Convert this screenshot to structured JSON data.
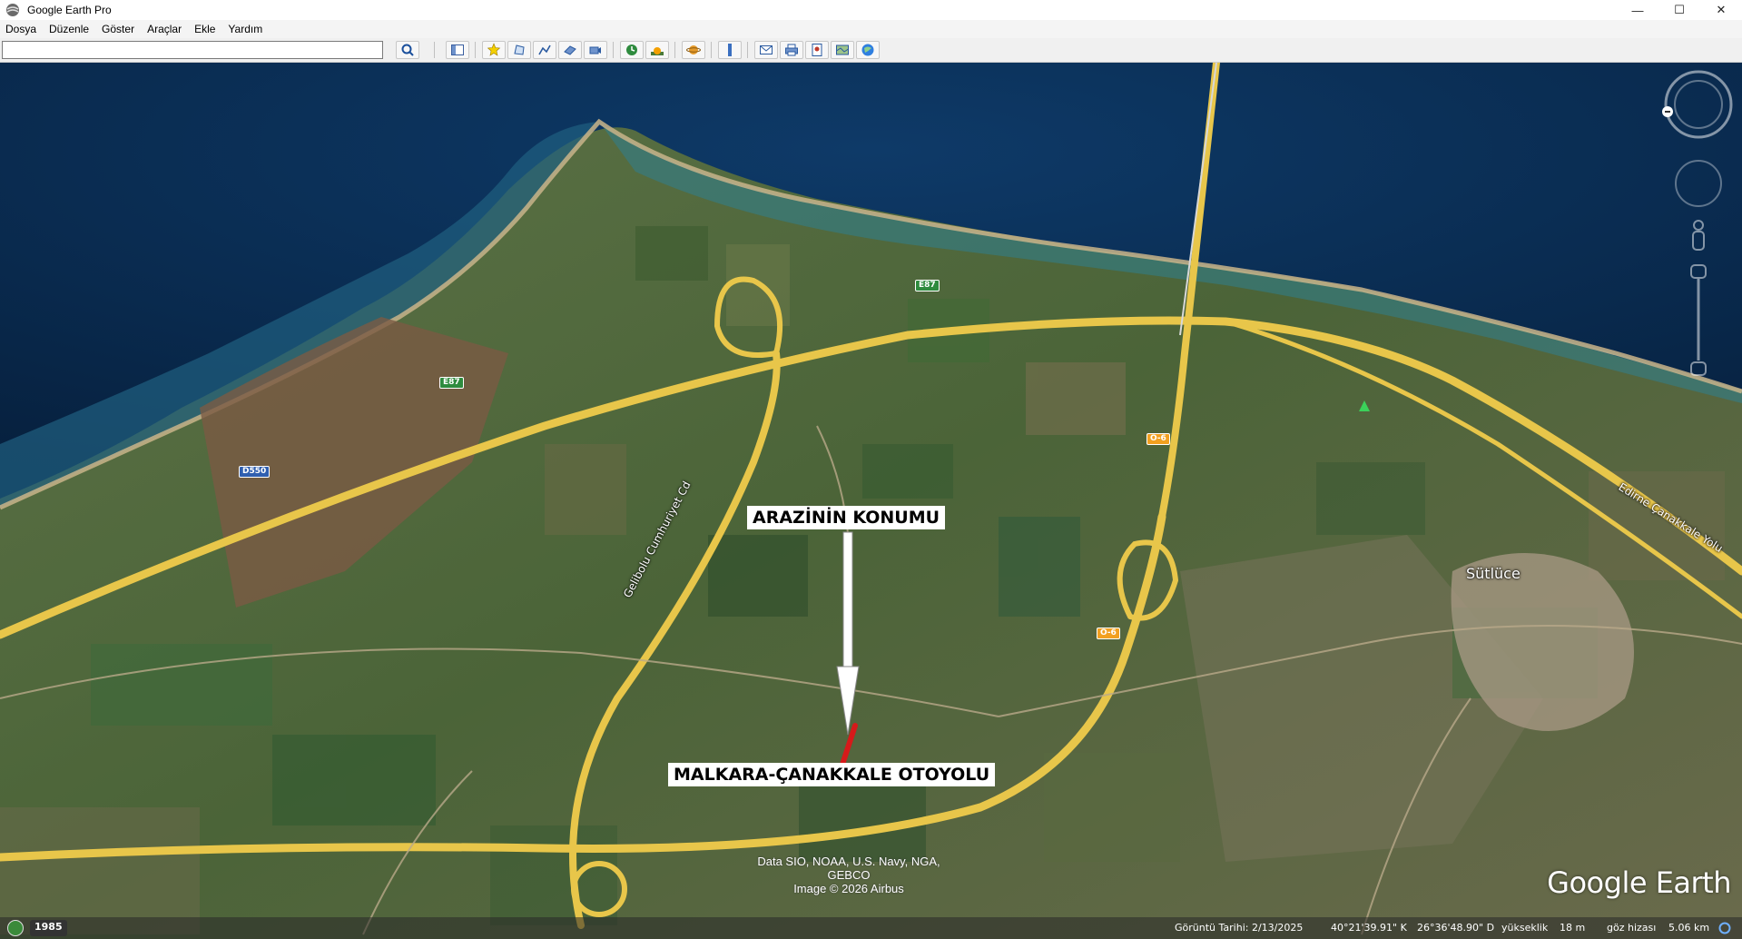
{
  "window": {
    "title": "Google Earth Pro",
    "controls": {
      "minimize": "—",
      "maximize": "☐",
      "close": "✕"
    }
  },
  "menu": [
    "Dosya",
    "Düzenle",
    "Göster",
    "Araçlar",
    "Ekle",
    "Yardım"
  ],
  "search": {
    "value": "",
    "placeholder": ""
  },
  "toolbar_icons": [
    "search-icon",
    "sidebar-toggle-icon",
    "placemark-icon",
    "polygon-icon",
    "path-icon",
    "image-overlay-icon",
    "record-tour-icon",
    "historical-imagery-icon",
    "sunlight-icon",
    "planets-icon",
    "ruler-icon",
    "email-icon",
    "print-icon",
    "save-image-icon",
    "map-icon",
    "google-earth-web-icon"
  ],
  "map": {
    "annotations": {
      "parcel_location": "ARAZİNİN KONUMU",
      "highway": "MALKARA-ÇANAKKALE OTOYOLU"
    },
    "places": {
      "town": "Sütlüce",
      "road_west": "Gelibolu Cumhuriyet Cd",
      "road_east": "Edirne Çanakkale Yolu"
    },
    "shields": {
      "e87_a": "E87",
      "e87_b": "E87",
      "d550": "D550",
      "o6_a": "O-6",
      "o6_b": "O-6"
    },
    "credits": [
      "Data SIO, NOAA, U.S. Navy, NGA, GEBCO",
      "Image © 2026 Airbus"
    ],
    "logo": "Google Earth"
  },
  "status": {
    "year": "1985",
    "imagery_date": "Görüntü Tarihi: 2/13/2025",
    "latitude": "40°21'39.91\" K",
    "longitude": "26°36'48.90\" D",
    "elevation_label": "yükseklik",
    "elevation": "18 m",
    "eye_alt_label": "göz hizası",
    "eye_alt": "5.06 km"
  },
  "colors": {
    "sea": "#0b2f55",
    "shallow": "#1d5e78",
    "field": "#4f6a3a",
    "road": "#e8c64a",
    "marker": "#d61a1a"
  }
}
